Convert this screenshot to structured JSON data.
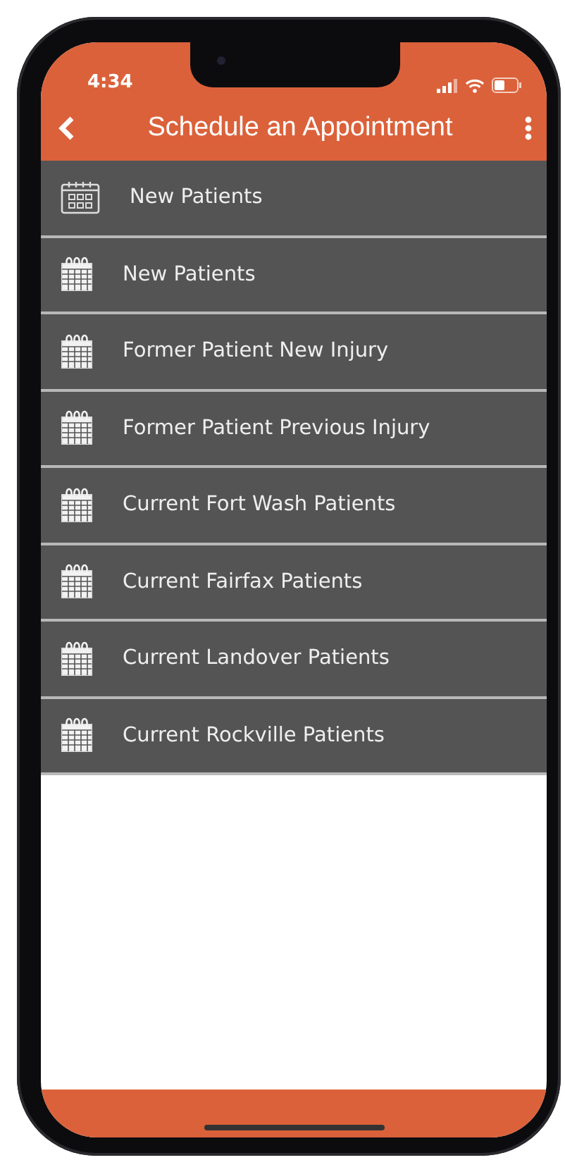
{
  "status_bar": {
    "time": "4:34"
  },
  "header": {
    "title": "Schedule an Appointment"
  },
  "items": [
    {
      "label": "New Patients",
      "kind": "grid"
    },
    {
      "label": "New Patients",
      "kind": "ringed"
    },
    {
      "label": "Former Patient New Injury",
      "kind": "ringed"
    },
    {
      "label": "Former Patient Previous Injury",
      "kind": "ringed"
    },
    {
      "label": "Current Fort Wash Patients",
      "kind": "ringed"
    },
    {
      "label": "Current Fairfax Patients",
      "kind": "ringed"
    },
    {
      "label": "Current Landover Patients",
      "kind": "ringed"
    },
    {
      "label": "Current Rockville Patients",
      "kind": "ringed"
    }
  ]
}
